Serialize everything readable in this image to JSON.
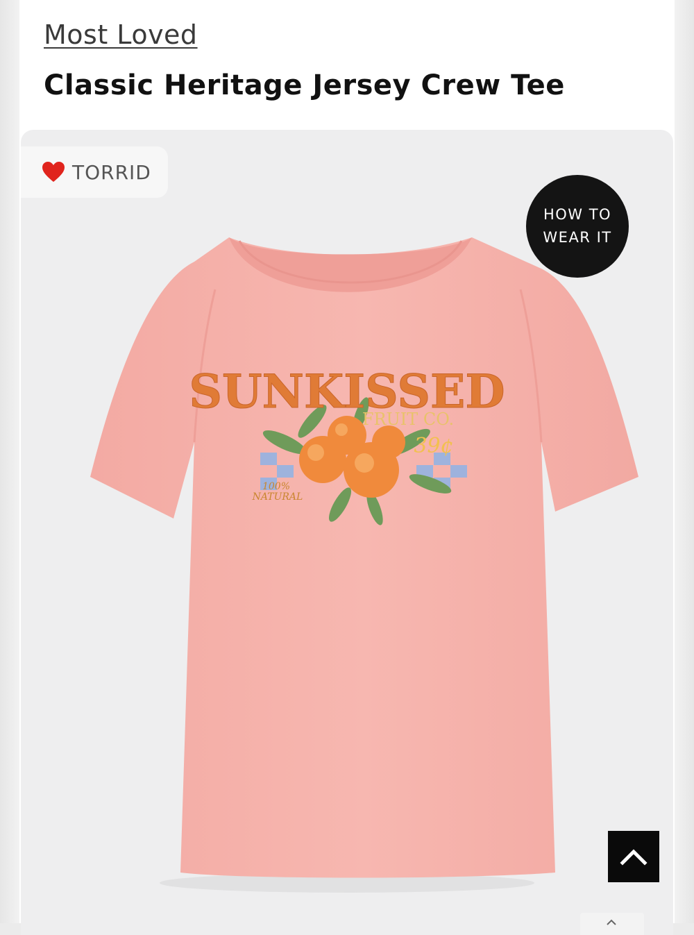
{
  "breadcrumb": {
    "category_label": "Most Loved"
  },
  "product": {
    "title": "Classic Heritage Jersey Crew Tee"
  },
  "image": {
    "brand_chip": {
      "brand": "TORRID",
      "icon": "heart-icon"
    },
    "how_to_wear": {
      "line1": "HOW TO",
      "line2": "WEAR IT"
    },
    "graphic": {
      "headline": "SUNKISSED",
      "subline": "FRUIT CO.",
      "price": "39¢",
      "badge_line1": "100%",
      "badge_line2": "NATURAL"
    },
    "colors": {
      "tee": "#f6b2ab",
      "background": "#eeeeef",
      "accent_dark": "#141414"
    }
  },
  "controls": {
    "scroll_top_icon": "chevron-up-icon"
  }
}
